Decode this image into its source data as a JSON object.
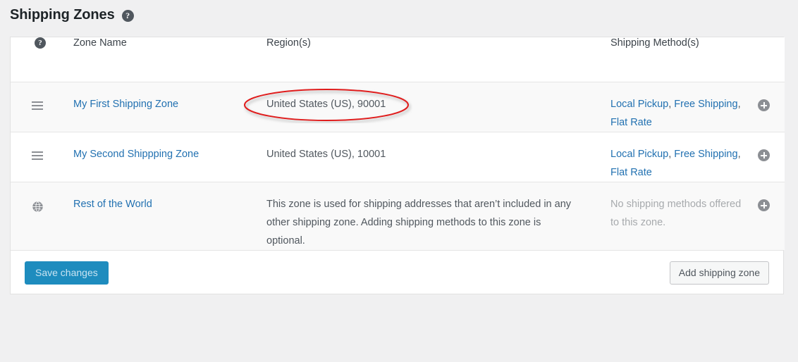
{
  "page": {
    "title": "Shipping Zones",
    "help_icon_glyph": "?",
    "background_color": "#f0f0f1",
    "link_color": "#2271b1",
    "muted_color": "#a7aaad"
  },
  "table": {
    "columns": [
      {
        "key": "handle",
        "label": "",
        "icon": "help-icon"
      },
      {
        "key": "zone_name",
        "label": "Zone Name"
      },
      {
        "key": "regions",
        "label": "Region(s)"
      },
      {
        "key": "methods",
        "label": "Shipping Method(s)"
      }
    ],
    "rows": [
      {
        "handle_icon": "drag-handle-icon",
        "zone_name": "My First Shipping Zone",
        "regions": "United States (US), 90001",
        "methods": "Local Pickup, Free Shipping, Flat Rate",
        "method_items": [
          "Local Pickup",
          "Free Shipping",
          "Flat Rate"
        ],
        "methods_muted": false,
        "action_icon": "add-circle-icon"
      },
      {
        "handle_icon": "drag-handle-icon",
        "zone_name": "My Second Shippping Zone",
        "regions": "United States (US), 10001",
        "methods": "Local Pickup, Free Shipping, Flat Rate",
        "method_items": [
          "Local Pickup",
          "Free Shipping",
          "Flat Rate"
        ],
        "methods_muted": false,
        "action_icon": "add-circle-icon"
      },
      {
        "handle_icon": "globe-icon",
        "zone_name": "Rest of the World",
        "regions": "This zone is used for shipping addresses that aren’t included in any other shipping zone. Adding shipping methods to this zone is optional.",
        "methods": "No shipping methods offered to this zone.",
        "method_items": [],
        "methods_muted": true,
        "action_icon": "add-circle-icon"
      }
    ]
  },
  "footer": {
    "save_label": "Save changes",
    "add_zone_label": "Add shipping zone",
    "save_button_color": "#1e8cbe"
  },
  "annotation": {
    "type": "ellipse",
    "color": "#e01b1b",
    "targets": "United States (US), 90001"
  }
}
